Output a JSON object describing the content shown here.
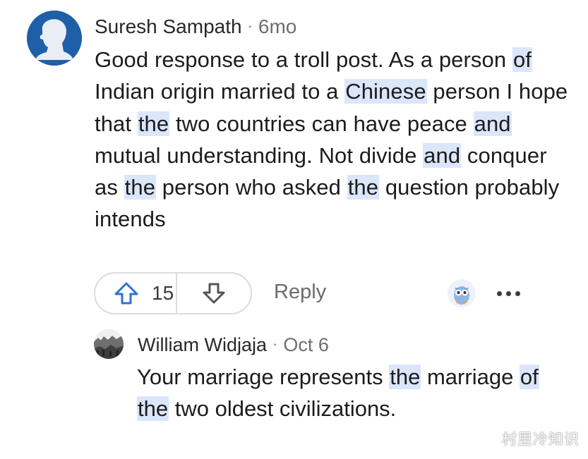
{
  "comment": {
    "author": "Suresh Sampath",
    "separator": "·",
    "time": "6mo",
    "body": [
      {
        "t": "Good response to a troll post. As a person "
      },
      {
        "t": "of",
        "hl": true
      },
      {
        "t": " Indian origin married to a "
      },
      {
        "t": "Chinese",
        "hl": true
      },
      {
        "t": " person I hope that "
      },
      {
        "t": "the",
        "hl": true
      },
      {
        "t": " two countries can have peace "
      },
      {
        "t": "and",
        "hl": true
      },
      {
        "t": " mutual understanding. Not divide "
      },
      {
        "t": "and",
        "hl": true
      },
      {
        "t": " conquer as "
      },
      {
        "t": "the",
        "hl": true
      },
      {
        "t": " person who asked "
      },
      {
        "t": "the",
        "hl": true
      },
      {
        "t": " question probably intends"
      }
    ],
    "upvotes": "15",
    "reply_label": "Reply"
  },
  "reply": {
    "author": "William Widjaja",
    "separator": "·",
    "time": "Oct 6",
    "body": [
      {
        "t": "Your marriage represents "
      },
      {
        "t": "the",
        "hl": true
      },
      {
        "t": " marriage "
      },
      {
        "t": "of",
        "hl": true
      },
      {
        "t": " "
      },
      {
        "t": "the",
        "hl": true
      },
      {
        "t": " two oldest civilizations."
      }
    ]
  },
  "watermark": "村里冷知识",
  "colors": {
    "accent_blue": "#2f6fdb",
    "highlight": "#dbe6fb",
    "avatar_bg": "#1f5fa8"
  },
  "icons": {
    "upvote": "arrow-up-icon",
    "downvote": "arrow-down-icon",
    "more": "more-horizontal-icon"
  }
}
